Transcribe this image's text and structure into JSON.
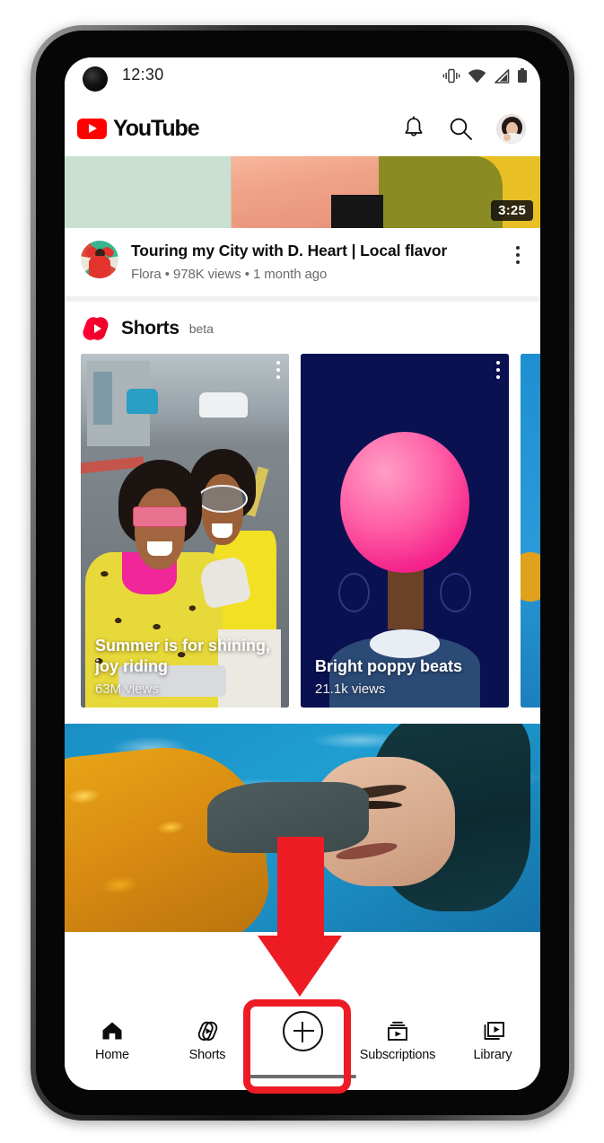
{
  "device": {
    "name": "android-phone-mockup",
    "status_bar": {
      "time": "12:30",
      "icons": [
        "vibrate-icon",
        "wifi-icon",
        "cellular-signal-icon",
        "battery-icon"
      ]
    }
  },
  "app": {
    "name": "YouTube",
    "brand_color": "#ff0000",
    "header": {
      "logo_text": "YouTube",
      "actions": [
        {
          "name": "notifications-bell-icon",
          "label": "Notifications"
        },
        {
          "name": "search-icon",
          "label": "Search"
        },
        {
          "name": "account-avatar",
          "label": "Account"
        }
      ]
    }
  },
  "feed": {
    "video1": {
      "duration": "3:25",
      "title": "Touring my City with D. Heart  | Local flavor",
      "channel": "Flora",
      "views": "978K views",
      "age": "1 month ago",
      "meta_line": "Flora  •  978K views • 1 month ago",
      "menu_icon": "kebab-menu-icon"
    },
    "shorts_shelf": {
      "title": "Shorts",
      "badge": "beta",
      "logo_icon": "shorts-logo-icon",
      "cards": [
        {
          "caption": "Summer is for shining, joy riding",
          "views": "63M views",
          "menu_icon": "kebab-menu-icon"
        },
        {
          "caption": "Bright poppy beats",
          "views": "21.1k views",
          "menu_icon": "kebab-menu-icon"
        },
        {
          "caption": "",
          "views": "",
          "menu_icon": "kebab-menu-icon"
        }
      ]
    },
    "video2": {
      "alt": "woman floating in pool water"
    }
  },
  "bottom_nav": {
    "items": [
      {
        "label": "Home",
        "icon": "home-icon"
      },
      {
        "label": "Shorts",
        "icon": "shorts-icon"
      },
      {
        "label": "",
        "icon": "create-plus-icon"
      },
      {
        "label": "Subscriptions",
        "icon": "subscriptions-icon"
      },
      {
        "label": "Library",
        "icon": "library-icon"
      }
    ]
  },
  "annotation": {
    "arrow_color": "#ed1c24",
    "highlight_color": "#ed1c24",
    "points_to": "create-plus-icon"
  }
}
